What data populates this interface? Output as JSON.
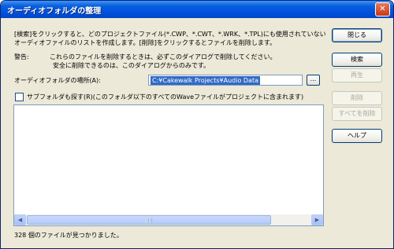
{
  "window": {
    "title": "オーディオフォルダの整理",
    "close_glyph": "✕"
  },
  "description": {
    "line1": "[検索]をクリックすると、どのプロジェクトファイル(*.CWP、*.CWT、*.WRK、*.TPL)にも使用されていない",
    "line2": "オーディオファイルのリストを作成します。[削除]をクリックするとファイルを削除します。"
  },
  "warning": {
    "label": "警告:",
    "line1": "これらのファイルを削除するときは、必ずこのダイアログで削除してください。",
    "line2": "安全に削除できるのは、このダイアログからのみです。"
  },
  "location": {
    "label": "オーディオフォルダの場所(A):",
    "value": "C:¥Cakewalk Projects¥Audio Data",
    "browse_label": "..."
  },
  "subfolder": {
    "label": "サブフォルダも探す(R)(このフォルダ以下のすべてのWaveファイルがプロジェクトに含まれます)",
    "checked": false
  },
  "buttons": {
    "close": "閉じる",
    "search": "検索",
    "play": "再生",
    "delete": "削除",
    "delete_all": "すべてを削除",
    "help": "ヘルプ"
  },
  "status": "328 個のファイルが見つかりました。"
}
